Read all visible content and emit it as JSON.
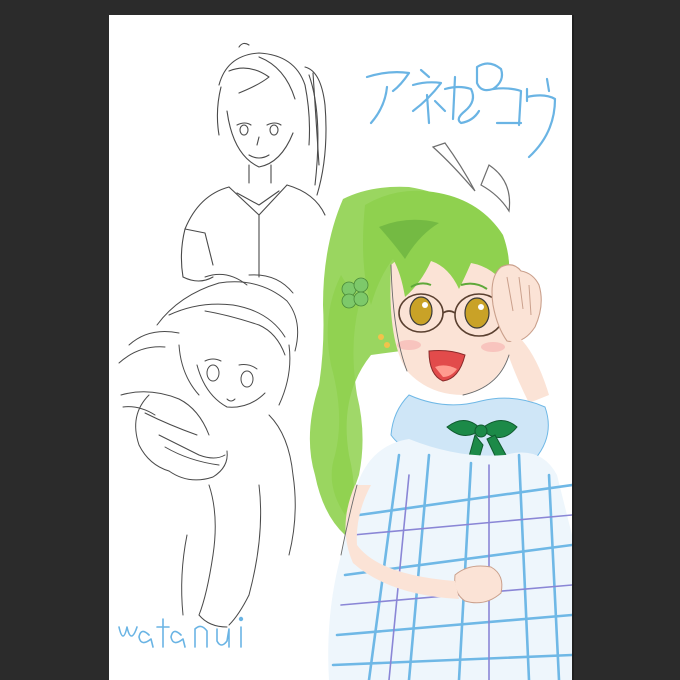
{
  "artwork": {
    "title_text": "アネねコウ",
    "signature_text": "watanui",
    "colors": {
      "workspace": "#2b2b2b",
      "paper": "#ffffff",
      "sketch_line": "#4a4a4a",
      "hair_green": "#8fd14f",
      "hair_shadow": "#5fa83a",
      "bow_green": "#1c8a48",
      "plaid_blue": "#6fb8e6",
      "plaid_purple": "#8a86d6",
      "skin": "#fbe3d6",
      "eye": "#c9a227",
      "title_blue": "#6ab4e4"
    },
    "figures": [
      {
        "name": "sketch-standing-character",
        "style": "pencil-sketch"
      },
      {
        "name": "sketch-crouching-character",
        "style": "pencil-sketch"
      },
      {
        "name": "colored-girl-with-glasses",
        "style": "colored"
      }
    ]
  }
}
